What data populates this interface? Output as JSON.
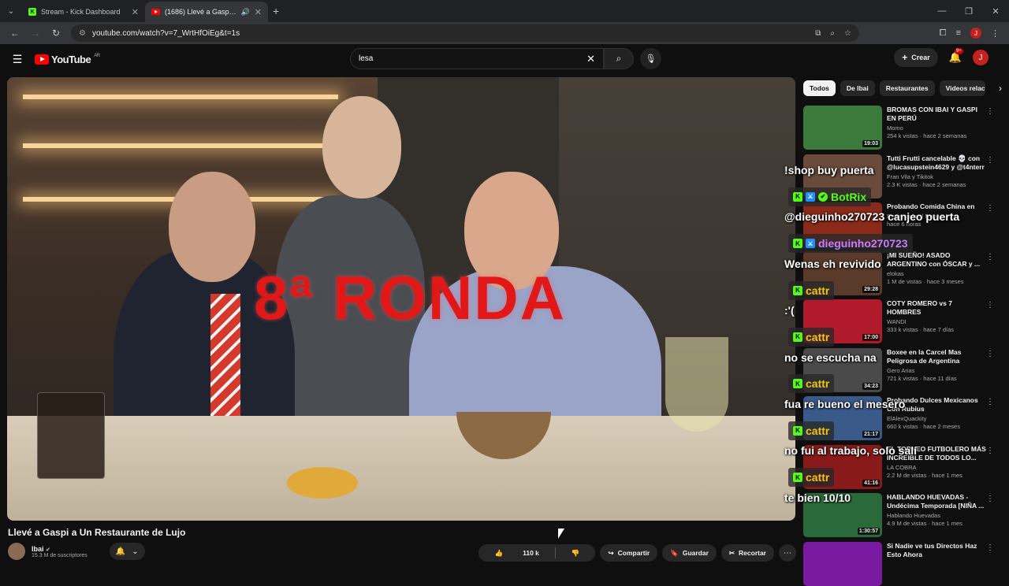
{
  "browser": {
    "tabs": [
      {
        "title": "Stream - Kick Dashboard",
        "active": false
      },
      {
        "title": "(1686) Llevé a Gaspi a Un Restaurante de Lujo",
        "active": true
      }
    ],
    "url": "youtube.com/watch?v=7_WrtHfOiEg&t=1s",
    "profile_initial": "J"
  },
  "youtube": {
    "logo": "YouTube",
    "region": "AR",
    "search_value": "lesa",
    "create_label": "Crear",
    "notif_badge": "9+",
    "avatar_initial": "J"
  },
  "video": {
    "overlay_text": "8ª RONDA",
    "title": "Llevé a Gaspi a Un Restaurante de Lujo",
    "channel": "Ibai",
    "subscribers": "15.3 M de suscriptores",
    "likes": "110 k",
    "share_label": "Compartir",
    "save_label": "Guardar",
    "clip_label": "Recortar"
  },
  "chips": [
    "Todos",
    "De Ibai",
    "Restaurantes",
    "Videos relac"
  ],
  "recommended": [
    {
      "title": "BROMAS CON IBAI Y GASPI EN PERÚ",
      "channel": "Momo",
      "views": "254 k vistas · hace 2 semanas",
      "duration": "19:03",
      "color": "#3b7a3a"
    },
    {
      "title": "Tutti Frutti cancelable 💀 con @lucasupstein4629 y @t4nterr",
      "channel": "Fran Vila y Tikitok",
      "views": "2.3 K vistas · hace 2 semanas",
      "duration": "",
      "color": "#6a4a3a"
    },
    {
      "title": "Probando Comida China en",
      "channel": "Repintando el Mapa",
      "views": "hace 6 horas",
      "duration": "",
      "color": "#8a2a1a"
    },
    {
      "title": "¡MI SUEÑO! ASADO ARGENTINO con ÓSCAR y ...",
      "channel": "elokas",
      "views": "1 M de vistas · hace 3 meses",
      "duration": "29:28",
      "color": "#5a3a2a"
    },
    {
      "title": "COTY ROMERO vs 7 HOMBRES",
      "channel": "WANDI",
      "views": "333 k vistas · hace 7 días",
      "duration": "17:00",
      "color": "#b01a2a"
    },
    {
      "title": "Boxee en la Carcel Mas Peligrosa de Argentina",
      "channel": "Gero Arias",
      "views": "721 k vistas · hace 11 días",
      "duration": "34:23",
      "color": "#4a4a4a"
    },
    {
      "title": "Probando Dulces Mexicanos Con Rubius",
      "channel": "ElAlexQuackity",
      "views": "660 k vistas · hace 2 meses",
      "duration": "21:17",
      "color": "#3a5a8a"
    },
    {
      "title": "EL TORNEO FUTBOLERO MÁS INCREÍBLE DE TODOS LO...",
      "channel": "LA COBRA",
      "views": "2.2 M de vistas · hace 1 mes",
      "duration": "41:16",
      "color": "#8a1a1a"
    },
    {
      "title": "HABLANDO HUEVADAS - Undécima Temporada [NIÑA ...",
      "channel": "Hablando Huevadas",
      "views": "4.9 M de vistas · hace 1 mes",
      "duration": "1:30:57",
      "color": "#2a6a3a"
    },
    {
      "title": "Si Nadie ve tus Directos Haz Esto Ahora",
      "channel": "",
      "views": "",
      "duration": "",
      "color": "#7a1aa0"
    }
  ],
  "chat": [
    {
      "type": "msg",
      "text": "!shop buy puerta"
    },
    {
      "type": "user",
      "name": "BotRix",
      "color": "#53fc18",
      "badges": 3
    },
    {
      "type": "msg",
      "text": "@dieguinho270723 canjeo puerta"
    },
    {
      "type": "user",
      "name": "dieguinho270723",
      "color": "#c77dff",
      "badges": 2
    },
    {
      "type": "msg",
      "text": "Wenas eh revivido"
    },
    {
      "type": "user",
      "name": "cattr",
      "color": "#f1c40f",
      "badges": 1
    },
    {
      "type": "msg",
      "text": ":'("
    },
    {
      "type": "user",
      "name": "cattr",
      "color": "#f1c40f",
      "badges": 1
    },
    {
      "type": "msg",
      "text": "no se escucha na"
    },
    {
      "type": "user",
      "name": "cattr",
      "color": "#f1c40f",
      "badges": 1
    },
    {
      "type": "msg",
      "text": "fua re bueno el mesero"
    },
    {
      "type": "user",
      "name": "cattr",
      "color": "#f1c40f",
      "badges": 1
    },
    {
      "type": "msg",
      "text": "no fui al trabajo, solo salí"
    },
    {
      "type": "user",
      "name": "cattr",
      "color": "#f1c40f",
      "badges": 1
    },
    {
      "type": "msg",
      "text": "te bien 10/10"
    }
  ]
}
